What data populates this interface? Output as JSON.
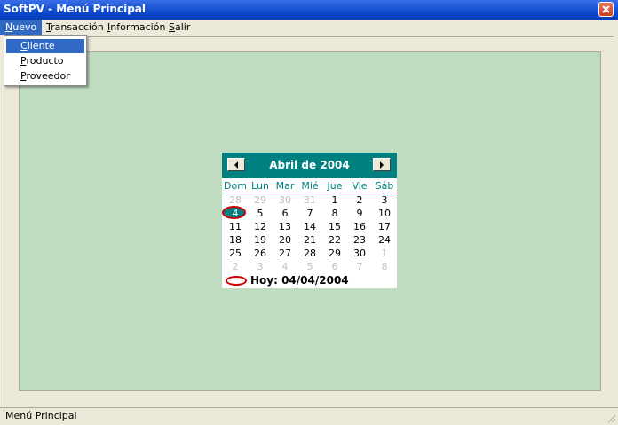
{
  "window": {
    "title": "SoftPV - Menú Principal"
  },
  "menubar": {
    "items": [
      {
        "label": "Nuevo",
        "mnemonic": "N",
        "rest": "uevo",
        "active": true
      },
      {
        "label": "Transacción",
        "mnemonic": "T",
        "rest": "ransacción"
      },
      {
        "label": "Información",
        "mnemonic": "I",
        "rest": "nformación"
      },
      {
        "label": "Salir",
        "mnemonic": "S",
        "rest": "alir"
      }
    ]
  },
  "dropdown": {
    "items": [
      {
        "label": "Cliente",
        "mnemonic": "C",
        "rest": "liente",
        "selected": true
      },
      {
        "label": "Producto",
        "mnemonic": "P",
        "rest": "roducto"
      },
      {
        "label": "Proveedor",
        "mnemonic": "P",
        "rest": "roveedor"
      }
    ]
  },
  "calendar": {
    "month_title": "Abril de 2004",
    "weekdays": [
      "Dom",
      "Lun",
      "Mar",
      "Mié",
      "Jue",
      "Vie",
      "Sáb"
    ],
    "weeks": [
      [
        "28",
        "29",
        "30",
        "31",
        "1",
        "2",
        "3"
      ],
      [
        "4",
        "5",
        "6",
        "7",
        "8",
        "9",
        "10"
      ],
      [
        "11",
        "12",
        "13",
        "14",
        "15",
        "16",
        "17"
      ],
      [
        "18",
        "19",
        "20",
        "21",
        "22",
        "23",
        "24"
      ],
      [
        "25",
        "26",
        "27",
        "28",
        "29",
        "30",
        "1"
      ],
      [
        "2",
        "3",
        "4",
        "5",
        "6",
        "7",
        "8"
      ]
    ],
    "selected_day": "4",
    "today_text": "Hoy: 04/04/2004",
    "colors": {
      "header": "#008080",
      "mark": "#cc0000",
      "dim": "#c0c0c0"
    }
  },
  "statusbar": {
    "text": "Menú Principal"
  },
  "icons": {
    "close": "close-icon",
    "prev": "left-arrow-icon",
    "next": "right-arrow-icon"
  }
}
